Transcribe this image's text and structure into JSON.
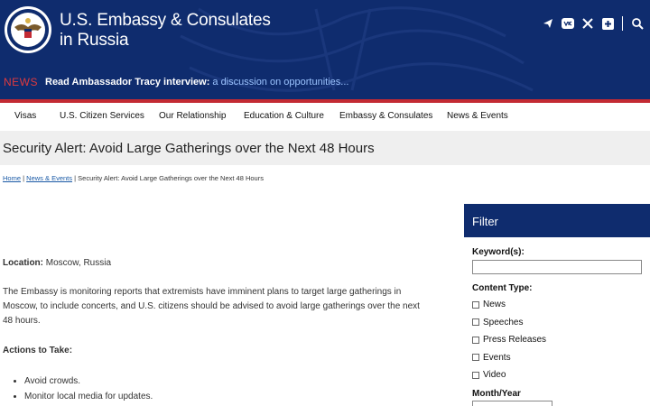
{
  "header": {
    "title_line1": "U.S. Embassy & Consulates",
    "title_line2": "in Russia",
    "social_icons": [
      "telegram-icon",
      "vk-icon",
      "x-icon",
      "plus-icon",
      "search-icon"
    ],
    "colors": {
      "navy": "#0f2c6e",
      "accent_red": "#c32a33",
      "link_blue": "#9cc4ff"
    }
  },
  "news": {
    "tag": "NEWS",
    "headline": "Read Ambassador Tracy interview:",
    "teaser": "a discussion on opportunities..."
  },
  "nav": {
    "items": [
      "Visas",
      "U.S. Citizen Services",
      "Our Relationship",
      "Education & Culture",
      "Embassy & Consulates",
      "News & Events"
    ]
  },
  "page": {
    "title": "Security Alert: Avoid Large Gatherings over the Next 48 Hours"
  },
  "breadcrumb": {
    "home": "Home",
    "sep": "|",
    "section": "News & Events",
    "current": "Security Alert: Avoid Large Gatherings over the Next 48 Hours"
  },
  "content": {
    "location_label": "Location:",
    "location_value": "Moscow, Russia",
    "paragraph": "The Embassy is monitoring reports that extremists have imminent plans to target large gatherings in Moscow, to include concerts, and U.S. citizens should be advised to avoid large gatherings over the next 48 hours.",
    "actions_heading": "Actions to Take:",
    "actions": [
      "Avoid crowds.",
      "Monitor local media for updates."
    ]
  },
  "filter": {
    "heading": "Filter",
    "keyword_label": "Keyword(s):",
    "content_type_label": "Content Type:",
    "content_types": [
      "News",
      "Speeches",
      "Press Releases",
      "Events",
      "Video"
    ],
    "month_year_label": "Month/Year"
  }
}
